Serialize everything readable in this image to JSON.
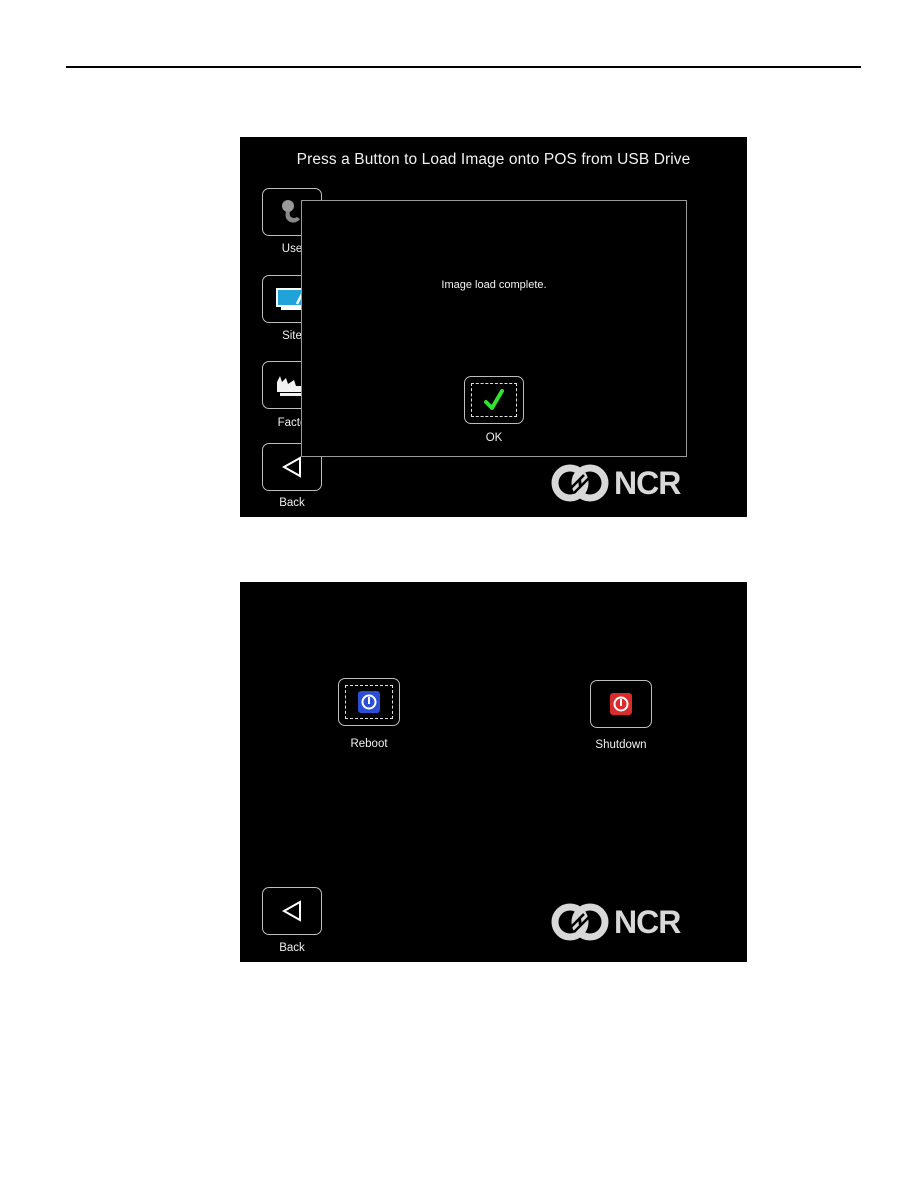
{
  "page": {
    "header_rule": true
  },
  "screen1": {
    "title": "Press a Button to Load Image onto POS from USB Drive",
    "side_buttons": [
      {
        "label": "User",
        "visible_label": "Use",
        "icon": "user-image-icon"
      },
      {
        "label": "Site",
        "visible_label": "Site",
        "icon": "monitor-icon"
      },
      {
        "label": "Factory",
        "visible_label": "Facto",
        "icon": "factory-icon"
      },
      {
        "label": "Back",
        "visible_label": "Back",
        "icon": "back-triangle-icon"
      }
    ],
    "dialog": {
      "message": "Image load complete.",
      "ok_label": "OK",
      "ok_icon": "checkmark-icon"
    },
    "logo": {
      "text": "NCR"
    }
  },
  "screen2": {
    "buttons": [
      {
        "label": "Reboot",
        "icon": "power-icon",
        "color": "#2a4fd6",
        "focused": true
      },
      {
        "label": "Shutdown",
        "icon": "power-icon",
        "color": "#d92b2b",
        "focused": false
      }
    ],
    "back_label": "Back",
    "logo": {
      "text": "NCR"
    }
  },
  "colors": {
    "screen_bg": "#000000",
    "check_green": "#33e033",
    "monitor_blue": "#1fa3d8",
    "reboot_blue": "#2a4fd6",
    "shutdown_red": "#d92b2b"
  }
}
